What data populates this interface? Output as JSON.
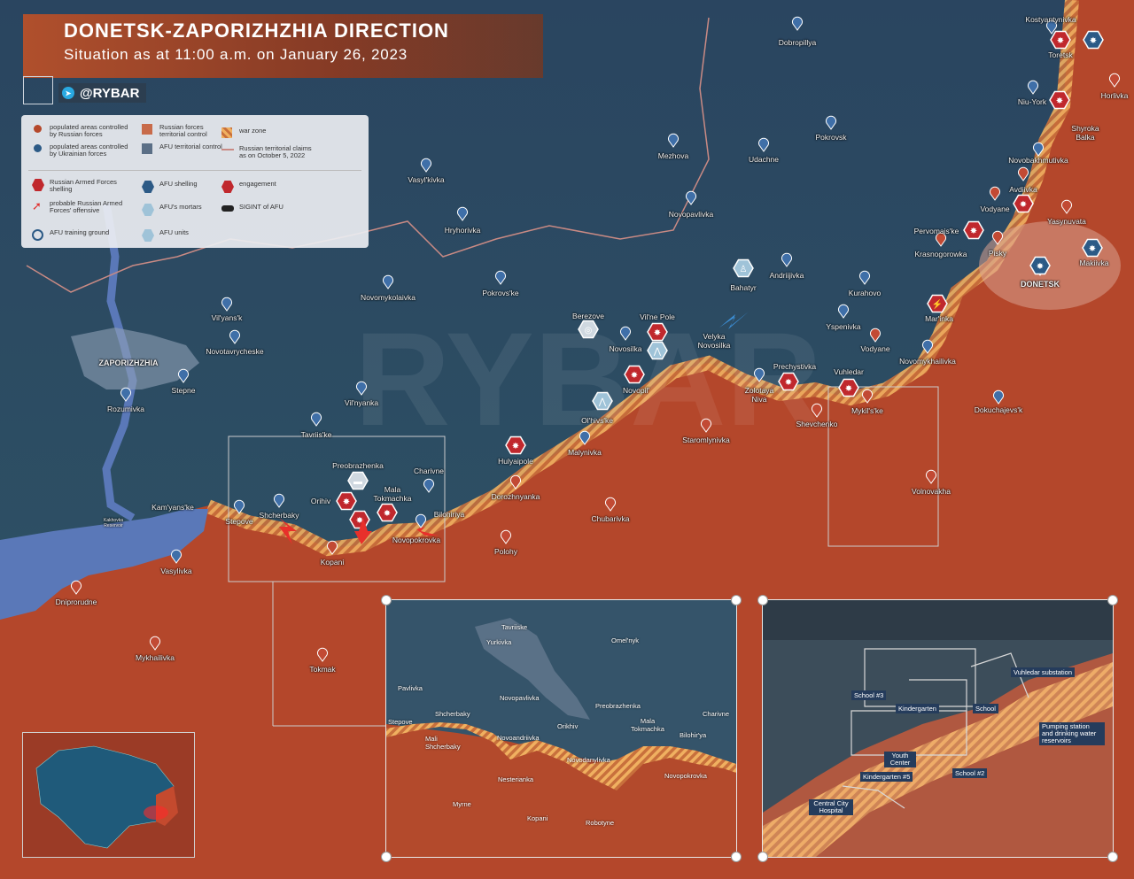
{
  "header": {
    "title": "DONETSK-ZAPORIZHZHIA DIRECTION",
    "subtitle": "Situation as at 11:00 a.m. on January 26, 2023",
    "brand": "@RYBAR",
    "watermark": "RYBAR"
  },
  "legend": {
    "ru_populated": "populated areas controlled by Russian forces",
    "ua_populated": "populated areas controlled by Ukrainian forces",
    "ru_control": "Russian forces territorial control",
    "afu_control": "AFU territorial control",
    "war_zone": "war zone",
    "claims": "Russian territorial claims as on October 5, 2022",
    "ru_shelling": "Russian Armed Forces shelling",
    "afu_shelling": "AFU shelling",
    "engagement": "engagement",
    "offensive": "probable Russian Armed Forces' offensive",
    "afu_mortars": "AFU's mortars",
    "sigint": "SIGINT of AFU",
    "training": "AFU training ground",
    "afu_units": "AFU units"
  },
  "colors": {
    "ru_territory": "#b5482b",
    "ua_territory": "#2c4b63",
    "war_zone": "#e8a050",
    "title_bg": "#b7502a"
  },
  "map_labels": {
    "kostyantynivka": "Kostyantynivka",
    "dobropillya": "Dobropillya",
    "toretsk": "Toretsk",
    "niu_york": "Niu-York",
    "horlivka": "Horlivka",
    "shyroka_balka": "Shyroka Balka",
    "pokrovsk": "Pokrovsk",
    "mezhova": "Mezhova",
    "udachne": "Udachne",
    "novobakhmutivka": "Novobakhmutivka",
    "avdiivka": "Avdiivka",
    "vodyane_n": "Vodyane",
    "yasynuvata": "Yasynuvata",
    "vasylkivka": "Vasyl'kivka",
    "hryhorivka": "Hryhorivka",
    "novopavlivka": "Novopavlivka",
    "pervomaiske": "Pervomais'ke",
    "makiivka": "Makiivka",
    "krasnogorowka": "Krasnogorowka",
    "pisky": "Pisky",
    "donetsk": "DONETSK",
    "pokrovske": "Pokrovs'ke",
    "bahatyr": "Bahatyr",
    "andriijivka": "Andriijivka",
    "kurahovo": "Kurahovo",
    "novomykolaivka": "Novomykolaivka",
    "berezove": "Berezove",
    "vilne_pole": "Vil'ne Pole",
    "marinka": "Mar'inka",
    "vilyansk": "Vil'yans'k",
    "yspenivka": "Yspenivka",
    "zaporizhzhia": "ZAPORIZHZHIA",
    "novatavrycheske": "Novotavrycheske",
    "novosilka": "Novosilka",
    "velyka_novosilka": "Velyka Novosilka",
    "vodyane_s": "Vodyane",
    "novomykhailivka": "Novomykhailivka",
    "novopil": "Novopil'",
    "prechystivka": "Prechystivka",
    "vuhledar": "Vuhledar",
    "stepne": "Stepne",
    "zolotaya_niva": "Zolotaya Niva",
    "mykilske": "Mykil's'ke",
    "rozumivka": "Rozumivka",
    "vilnyanka": "Vil'nyanka",
    "olhivske": "Ol'hivs'ke",
    "shevchenko": "Shevchenko",
    "dokuchajevsk": "Dokuchajevs'k",
    "tavriiske": "Tavriis'ke",
    "staromlynivka": "Staromlynivka",
    "hulyaipole": "Hulyaipole",
    "malynivka": "Malynivka",
    "preobrazhenka": "Preobrazhenka",
    "charivne": "Charivne",
    "orihiv": "Orihiv",
    "mala_tokmachka": "Mala Tokmachka",
    "dorozhnyanka": "Dorozhnyanka",
    "volnovakha": "Volnovakha",
    "kamyanske": "Kam'yans'ke",
    "shcherbaky": "Shcherbaky",
    "bilohiriya": "Bilohiriya",
    "stepove": "Stepove",
    "chubarivka": "Chubarivka",
    "novopokrovka": "Novopokrovka",
    "kopani": "Kopani",
    "polohy": "Polohy",
    "vasylivka": "Vasylivka",
    "dniprorudne": "Dniprorudne",
    "mykhailivka": "Mykhailivka",
    "tokmak": "Tokmak",
    "kakhovka": "Kakhovka Reservoir"
  },
  "inset_left": {
    "tavriiske": "Tavriiske",
    "yurkivka": "Yurkivka",
    "omelnyk": "Omel'nyk",
    "pavlivka": "Pavlivka",
    "novopavlivka": "Novopavlivka",
    "preobrazhenka": "Preobrazhenka",
    "shcherbaky": "Shcherbaky",
    "orikhiv": "Orikhiv",
    "charivne": "Charivne",
    "stepove": "Stepove",
    "mala_tokmachka": "Mala Tokmachka",
    "mali_shcherbaky": "Mali Shcherbaky",
    "novoandriivka": "Novoandriivka",
    "bilohiya": "Bilohir'ya",
    "novodanylivka": "Novodanylivka",
    "nesterianka": "Nesterianka",
    "novopokrovka": "Novopokrovka",
    "myrne": "Myrne",
    "kopani": "Kopani",
    "robotyne": "Robotyne"
  },
  "inset_right": {
    "vuhledar_substation": "Vuhledar substation",
    "school3": "School #3",
    "kindergarten": "Kindergarten",
    "school": "School",
    "pumping": "Pumping station and drinking water reservoirs",
    "youth_center": "Youth Center",
    "kindergarten5": "Kindergarten #5",
    "school2": "School #2",
    "hospital": "Central City Hospital"
  }
}
